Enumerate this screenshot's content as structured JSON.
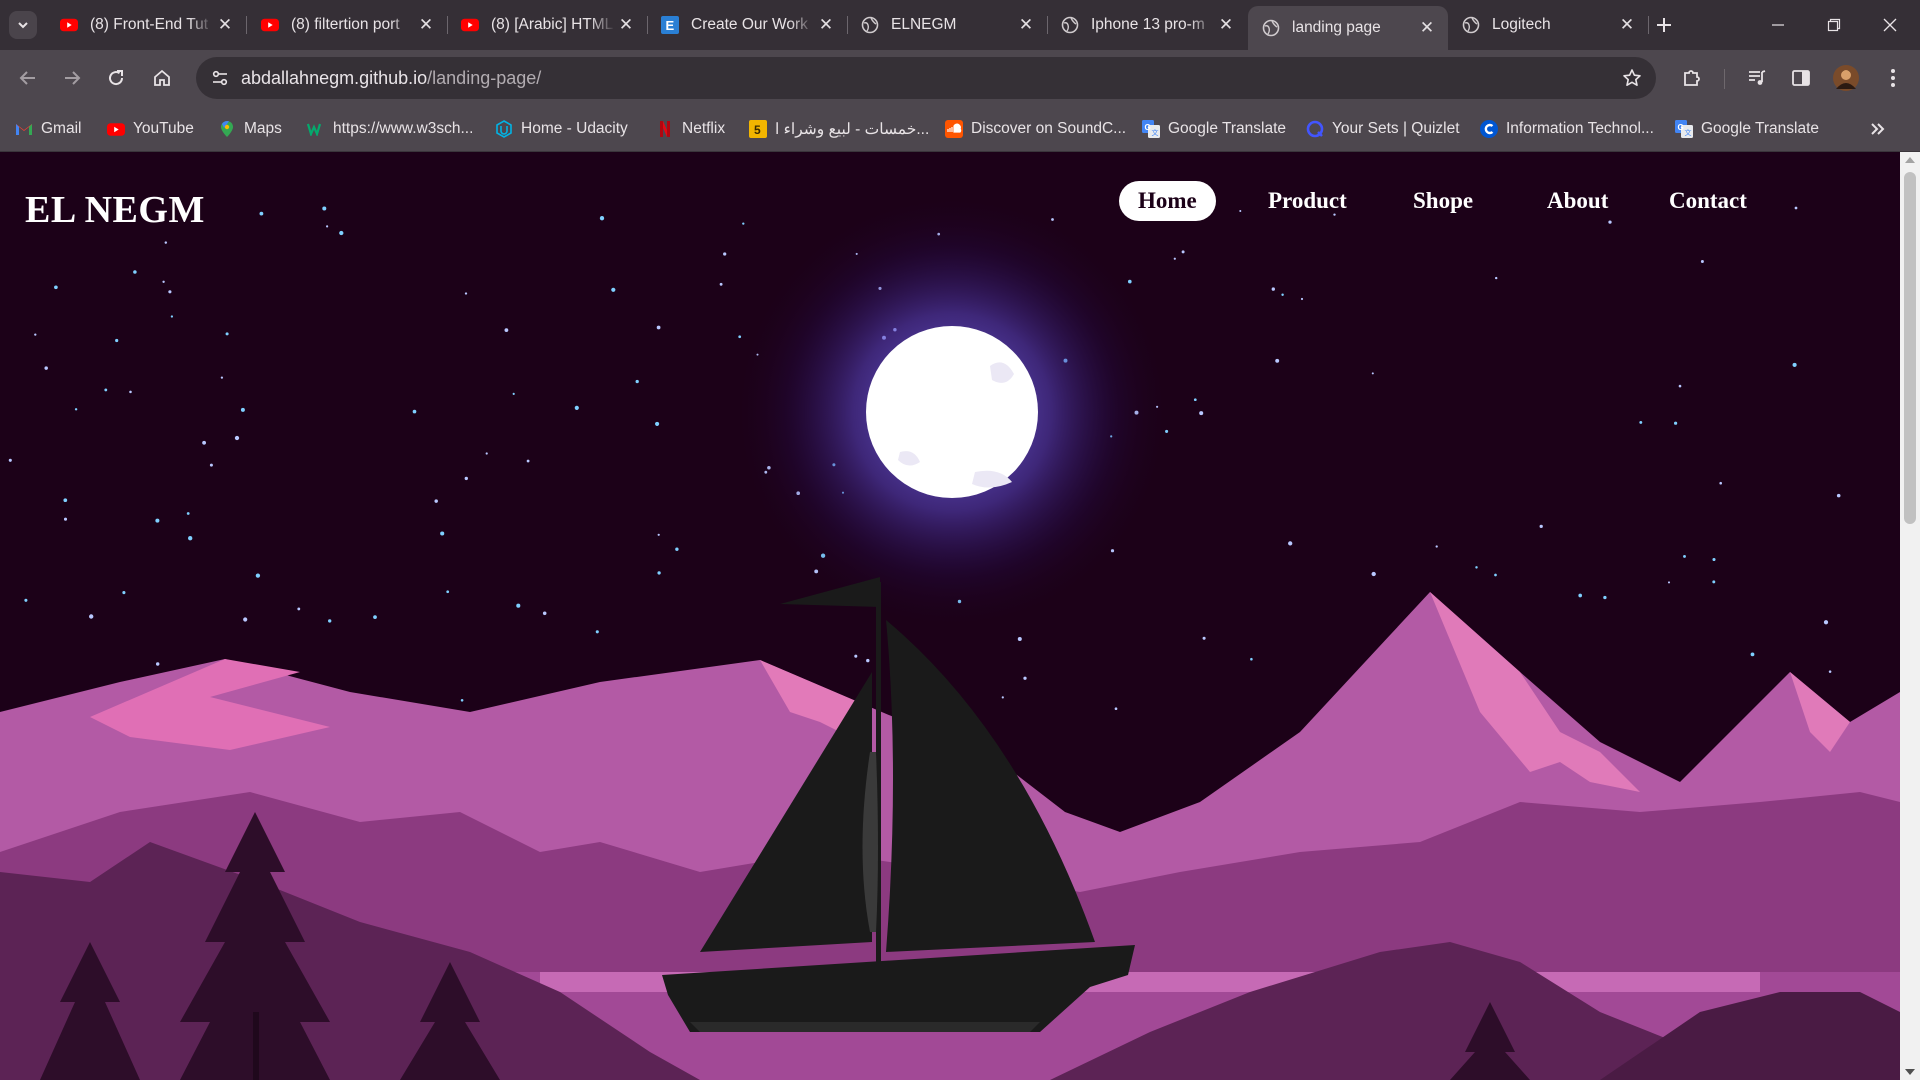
{
  "browser": {
    "tabs": [
      {
        "title": "(8) Front-End Tut",
        "favicon": "youtube-icon",
        "active": false
      },
      {
        "title": "(8) filtertion port",
        "favicon": "youtube-icon",
        "active": false
      },
      {
        "title": "(8) [Arabic] HTML",
        "favicon": "youtube-icon",
        "active": false
      },
      {
        "title": "Create Our Work",
        "favicon": "e-letter-icon",
        "active": false
      },
      {
        "title": "ELNEGM",
        "favicon": "globe-icon",
        "active": false
      },
      {
        "title": "Iphone 13 pro-m",
        "favicon": "globe-icon",
        "active": false
      },
      {
        "title": "landing page",
        "favicon": "globe-icon",
        "active": true
      },
      {
        "title": "Logitech",
        "favicon": "globe-icon",
        "active": false
      }
    ],
    "address": {
      "host": "abdallahnegm.github.io",
      "path": "/landing-page/"
    },
    "bookmarks": [
      {
        "label": "Gmail",
        "icon": "gmail-icon"
      },
      {
        "label": "YouTube",
        "icon": "youtube-icon"
      },
      {
        "label": "Maps",
        "icon": "maps-icon"
      },
      {
        "label": "https://www.w3sch...",
        "icon": "w3schools-icon"
      },
      {
        "label": "Home - Udacity",
        "icon": "udacity-icon"
      },
      {
        "label": "Netflix",
        "icon": "netflix-icon"
      },
      {
        "label": "خمسات - لبيع وشراء ا...",
        "icon": "khamsat-icon"
      },
      {
        "label": "Discover on SoundC...",
        "icon": "soundcloud-icon"
      },
      {
        "label": "Google Translate",
        "icon": "google-translate-icon"
      },
      {
        "label": "Your Sets | Quizlet",
        "icon": "quizlet-icon"
      },
      {
        "label": "Information Technol...",
        "icon": "coursera-icon"
      },
      {
        "label": "Google Translate",
        "icon": "google-translate-icon"
      }
    ]
  },
  "site": {
    "logo": "EL NEGM",
    "nav": [
      {
        "label": "Home",
        "active": true
      },
      {
        "label": "Product",
        "active": false
      },
      {
        "label": "Shope",
        "active": false
      },
      {
        "label": "About",
        "active": false
      },
      {
        "label": "Contact",
        "active": false
      }
    ]
  },
  "colors": {
    "sky": "#1c0118",
    "moon": "#ffffff",
    "moon_glow": "#7b6fe0",
    "mountain_light": "#b459a6",
    "mountain_mid": "#8b3a7f",
    "mountain_dark": "#5c2355",
    "boat": "#1a1a1a",
    "browser_frame": "#352f36"
  }
}
